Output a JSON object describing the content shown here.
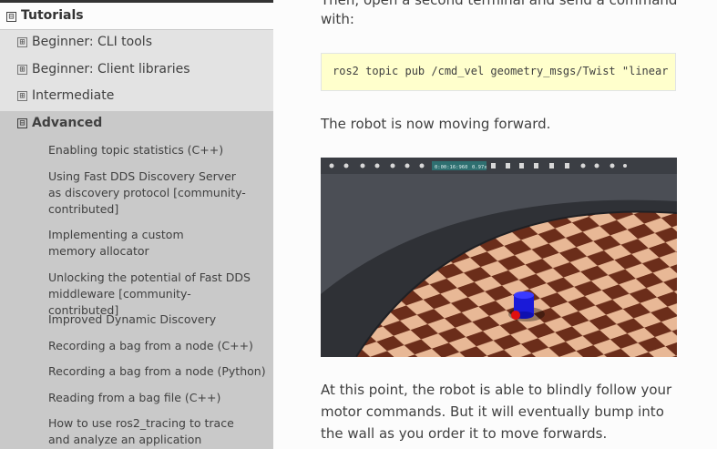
{
  "sidebar": {
    "section_title": "Tutorials",
    "section_toggle": "⊟",
    "groups": [
      {
        "label": "Beginner: CLI tools",
        "toggle": "⊞"
      },
      {
        "label": "Beginner: Client libraries",
        "toggle": "⊞"
      },
      {
        "label": "Intermediate",
        "toggle": "⊞"
      }
    ],
    "advanced": {
      "label": "Advanced",
      "toggle": "⊟"
    },
    "items": [
      "Enabling topic statistics (C++)",
      "Using Fast DDS Discovery Server as discovery protocol [community-contributed]",
      "Implementing a custom memory allocator",
      "Unlocking the potential of Fast DDS middleware [community-contributed]",
      "Improved Dynamic Discovery",
      "Recording a bag from a node (C++)",
      "Recording a bag from a node (Python)",
      "Reading from a bag file (C++)",
      "How to use ros2_tracing to trace and analyze an application"
    ]
  },
  "content": {
    "intro_line1": "Then, open a second terminal and send a command",
    "intro_line2": "with:",
    "code": "ros2 topic pub /cmd_vel geometry_msgs/Twist  \"linear",
    "moving": "The robot is now moving forward.",
    "simulator": {
      "time": "0:00:16:960",
      "rate": "0.97x"
    },
    "outro": "At this point, the robot is able to blindly follow your motor commands. But it will eventually bump into the wall as you order it to move forwards."
  },
  "colors": {
    "sidebar_bg": "#c9c9c9",
    "code_bg": "#ffffcc",
    "text": "#404040"
  }
}
